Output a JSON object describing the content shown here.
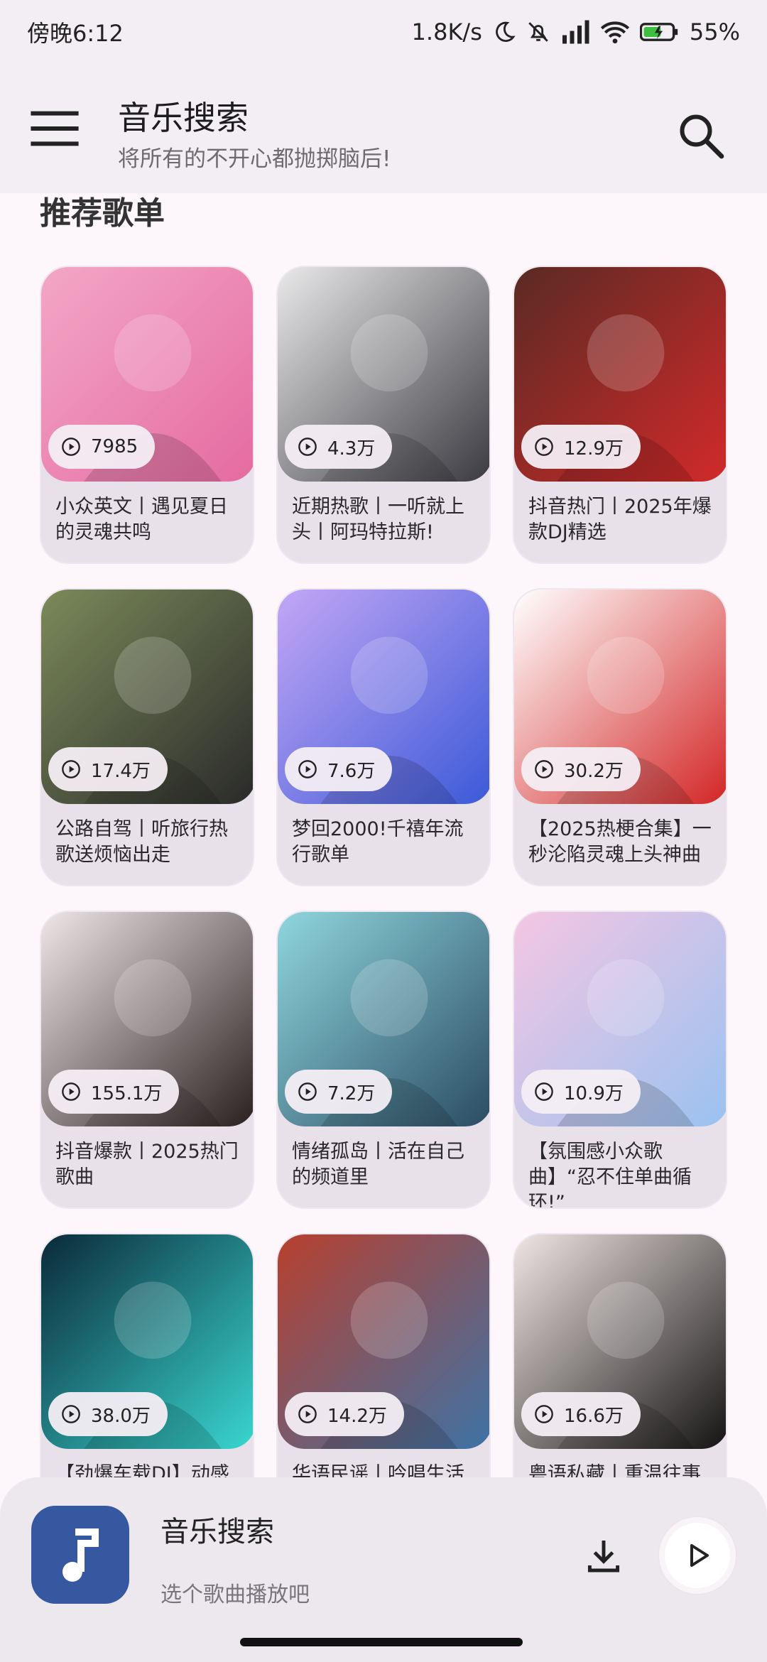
{
  "status": {
    "time": "傍晚6:12",
    "net_speed": "1.8K/s",
    "battery": "55%"
  },
  "app_bar": {
    "title": "音乐搜索",
    "subtitle": "将所有的不开心都抛掷脑后!"
  },
  "section": {
    "title": "推荐歌单"
  },
  "playlists": [
    {
      "plays": "7985",
      "title": "小众英文丨遇见夏日的灵魂共鸣",
      "colors": [
        "#f3a7c6",
        "#e56aa0"
      ]
    },
    {
      "plays": "4.3万",
      "title": "近期热歌丨一听就上头丨阿玛特拉斯!",
      "colors": [
        "#e9e9ea",
        "#3a3a40"
      ]
    },
    {
      "plays": "12.9万",
      "title": "抖音热门丨2025年爆款DJ精选",
      "colors": [
        "#5a2a24",
        "#d22a2a"
      ]
    },
    {
      "plays": "17.4万",
      "title": "公路自驾丨听旅行热歌送烦恼出走",
      "colors": [
        "#7c8a5a",
        "#2a2a2a"
      ]
    },
    {
      "plays": "7.6万",
      "title": "梦回2000!千禧年流行歌单",
      "colors": [
        "#c3a6f5",
        "#3b5ad8"
      ]
    },
    {
      "plays": "30.2万",
      "title": "【2025热梗合集】一秒沦陷灵魂上头神曲",
      "colors": [
        "#ffffff",
        "#d32525"
      ]
    },
    {
      "plays": "155.1万",
      "title": "抖音爆款丨2025热门歌曲",
      "colors": [
        "#efe6e8",
        "#2a2020"
      ]
    },
    {
      "plays": "7.2万",
      "title": "情绪孤岛丨活在自己的频道里",
      "colors": [
        "#8fd6de",
        "#2b4c63"
      ]
    },
    {
      "plays": "10.9万",
      "title": "【氛围感小众歌曲】“忍不住单曲循环!”",
      "colors": [
        "#f4c6e3",
        "#9ac2f0"
      ]
    },
    {
      "plays": "38.0万",
      "title": "【劲爆车载DJ】动感",
      "colors": [
        "#0b2a3a",
        "#39d7d0"
      ]
    },
    {
      "plays": "14.2万",
      "title": "华语民谣丨吟唱生活",
      "colors": [
        "#b8402e",
        "#3d73a6"
      ]
    },
    {
      "plays": "16.6万",
      "title": "粤语私藏丨重温往事",
      "colors": [
        "#efe6e4",
        "#141212"
      ]
    }
  ],
  "player": {
    "title": "音乐搜索",
    "subtitle": "选个歌曲播放吧"
  }
}
